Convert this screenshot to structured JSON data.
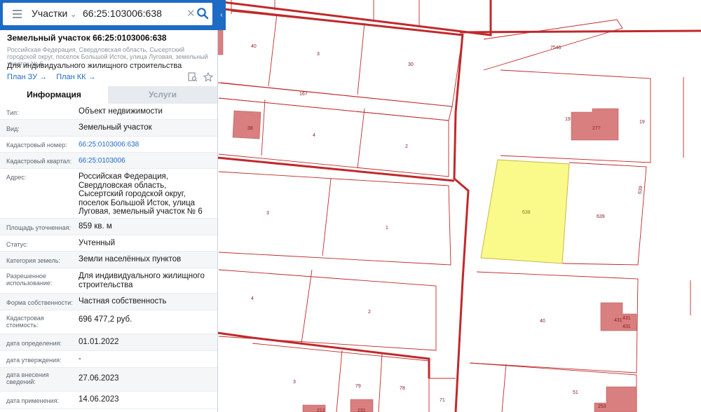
{
  "search": {
    "layer": "Участки",
    "query": "66:25:103006:638"
  },
  "card": {
    "title": "Земельный участок 66:25:0103006:638",
    "address_sub": "Российская Федерация, Свердловская область, Сысертский городской округ, поселок Большой Исток, улица Луговая, земельный участок № 6",
    "purpose": "Для индивидуального жилищного строительства",
    "link_plan_zu": "План ЗУ →",
    "link_plan_kk": "План КК →"
  },
  "tabs": {
    "info": "Информация",
    "services": "Услуги"
  },
  "info": [
    {
      "label": "Тип:",
      "value": "Объект недвижимости"
    },
    {
      "label": "Вид:",
      "value": "Земельный участок"
    },
    {
      "label": "Кадастровый номер:",
      "value": "66:25:0103006:638"
    },
    {
      "label": "Кадастровый квартал:",
      "value": "66:25:0103006"
    },
    {
      "label": "Адрес:",
      "value": "Российская Федерация, Свердловская область, Сысертский городской округ, поселок Большой Исток, улица Луговая, земельный участок № 6"
    },
    {
      "label": "Площадь уточненная:",
      "value": "859 кв. м"
    },
    {
      "label": "Статус:",
      "value": "Учтенный"
    },
    {
      "label": "Категория земель:",
      "value": "Земли населённых пунктов"
    },
    {
      "label": "Разрешенное использование:",
      "value": "Для индивидуального жилищного строительства"
    },
    {
      "label": "Форма собственности:",
      "value": "Частная собственность"
    },
    {
      "label": "Кадастровая стоимость:",
      "value": "696 477,2 руб."
    },
    {
      "label": "дата определения:",
      "value": "01.01.2022"
    },
    {
      "label": "дата утверждения:",
      "value": "-"
    },
    {
      "label": "дата внесения сведений:",
      "value": "27.06.2023"
    },
    {
      "label": "дата применения:",
      "value": "14.06.2023"
    }
  ],
  "map": {
    "selected_fill": "#fafa8a",
    "boundary_color": "#c0292b",
    "building_fill": "#d97f7f",
    "labels": {
      "p40a": "40",
      "p3a": "3",
      "p30": "30",
      "p167": "167",
      "p7545": "7545",
      "p38": "38",
      "p4a": "4",
      "p2a": "2",
      "p19a": "19",
      "p277": "277",
      "p19b": "19",
      "p638": "638",
      "p639a": "639",
      "p639b": "639",
      "p3b": "3",
      "p1": "1",
      "p4b": "4",
      "p2b": "2",
      "p40b": "40",
      "p431a": "431",
      "p431b": "431",
      "p431c": "431",
      "p3c": "3",
      "p79": "79",
      "p78": "78",
      "p71": "71",
      "p51": "51",
      "p253": "253",
      "p212": "212",
      "p231": "231"
    }
  }
}
